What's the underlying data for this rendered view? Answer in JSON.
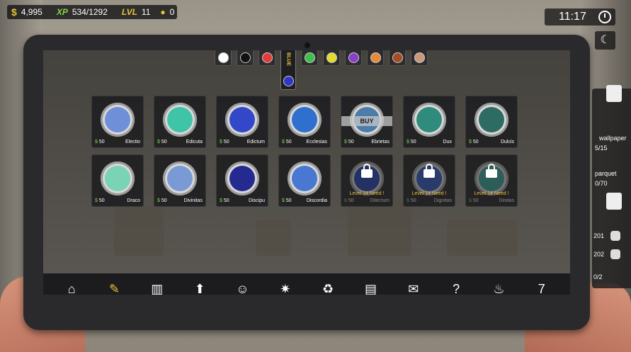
{
  "hud": {
    "money_icon": "$",
    "money": "4,995",
    "xp_icon": "XP",
    "xp": "534/1292",
    "lvl_icon": "LVL",
    "lvl": "11",
    "idea_count": "0",
    "time": "11:17"
  },
  "side": {
    "label_wallpaper": "wallpaper",
    "wallpaper_count": "5/15",
    "label_parquet": "parquet",
    "parquet_count": "0/70",
    "row1": "201",
    "row2": "202",
    "row3": "0/2"
  },
  "colors": {
    "active_label": "BLUE",
    "tabs": [
      "#ffffff",
      "#111111",
      "#e23b3b",
      "#3fbf4a",
      "#e4da2c",
      "#8a3fc8",
      "#e98a3a",
      "#a24e26",
      "#c9997a"
    ],
    "active_swatch": "#2f36c8"
  },
  "paints": [
    {
      "price": "50",
      "name": "Electio",
      "color": "#6f8fd8",
      "state": "buy"
    },
    {
      "price": "50",
      "name": "Edicuta",
      "color": "#3fc4a7",
      "state": "buy"
    },
    {
      "price": "50",
      "name": "Edictum",
      "color": "#3348c9",
      "state": "buy"
    },
    {
      "price": "50",
      "name": "Ecclesias",
      "color": "#2f6fce",
      "state": "buy"
    },
    {
      "price": "50",
      "name": "Ebrietas",
      "color": "#4d7ca8",
      "state": "buy-highlight",
      "overlay": "BUY"
    },
    {
      "price": "50",
      "name": "Dux",
      "color": "#2f8c7c",
      "state": "buy"
    },
    {
      "price": "50",
      "name": "Dulcis",
      "color": "#2e6b63",
      "state": "buy"
    },
    {
      "price": "50",
      "name": "Draco",
      "color": "#7ad3b4",
      "state": "buy"
    },
    {
      "price": "50",
      "name": "Divinitas",
      "color": "#7a9ad6",
      "state": "buy"
    },
    {
      "price": "50",
      "name": "Discipu",
      "color": "#242a8f",
      "state": "buy"
    },
    {
      "price": "50",
      "name": "Discordia",
      "color": "#4878d2",
      "state": "buy"
    },
    {
      "price": "50",
      "name": "Dilectum",
      "color": "#2342b5",
      "state": "locked",
      "level": "Level 14 Need !"
    },
    {
      "price": "50",
      "name": "Dignitas",
      "color": "#2f58bf",
      "state": "locked",
      "level": "Level 14 Need !"
    },
    {
      "price": "50",
      "name": "Dinitas",
      "color": "#3aa59a",
      "state": "locked",
      "level": "Level 14 Need !"
    }
  ],
  "nav": [
    {
      "label": "HOME",
      "icon": "home-icon",
      "glyph": "⌂"
    },
    {
      "label": "PAINT",
      "icon": "paint-roller-icon",
      "glyph": "✎",
      "active": true
    },
    {
      "label": "PARQUET",
      "icon": "parquet-icon",
      "glyph": "▥"
    },
    {
      "label": "UPGRADE",
      "icon": "upgrade-icon",
      "glyph": "⬆"
    },
    {
      "label": "WORKER",
      "icon": "worker-icon",
      "glyph": "☺"
    },
    {
      "label": "SKILL",
      "icon": "skill-icon",
      "glyph": "✷"
    },
    {
      "label": "GARBAGE",
      "icon": "garbage-truck-icon",
      "glyph": "♻"
    },
    {
      "label": "INCOME",
      "icon": "income-icon",
      "glyph": "▤"
    },
    {
      "label": "COMMENT",
      "icon": "comment-icon",
      "glyph": "✉"
    },
    {
      "label": "MYSTERY",
      "icon": "mystery-icon",
      "glyph": "?"
    },
    {
      "label": "COOK",
      "icon": "cook-icon",
      "glyph": "♨"
    },
    {
      "label": "LUCKGAME",
      "icon": "slot-machine-icon",
      "glyph": "7"
    }
  ]
}
